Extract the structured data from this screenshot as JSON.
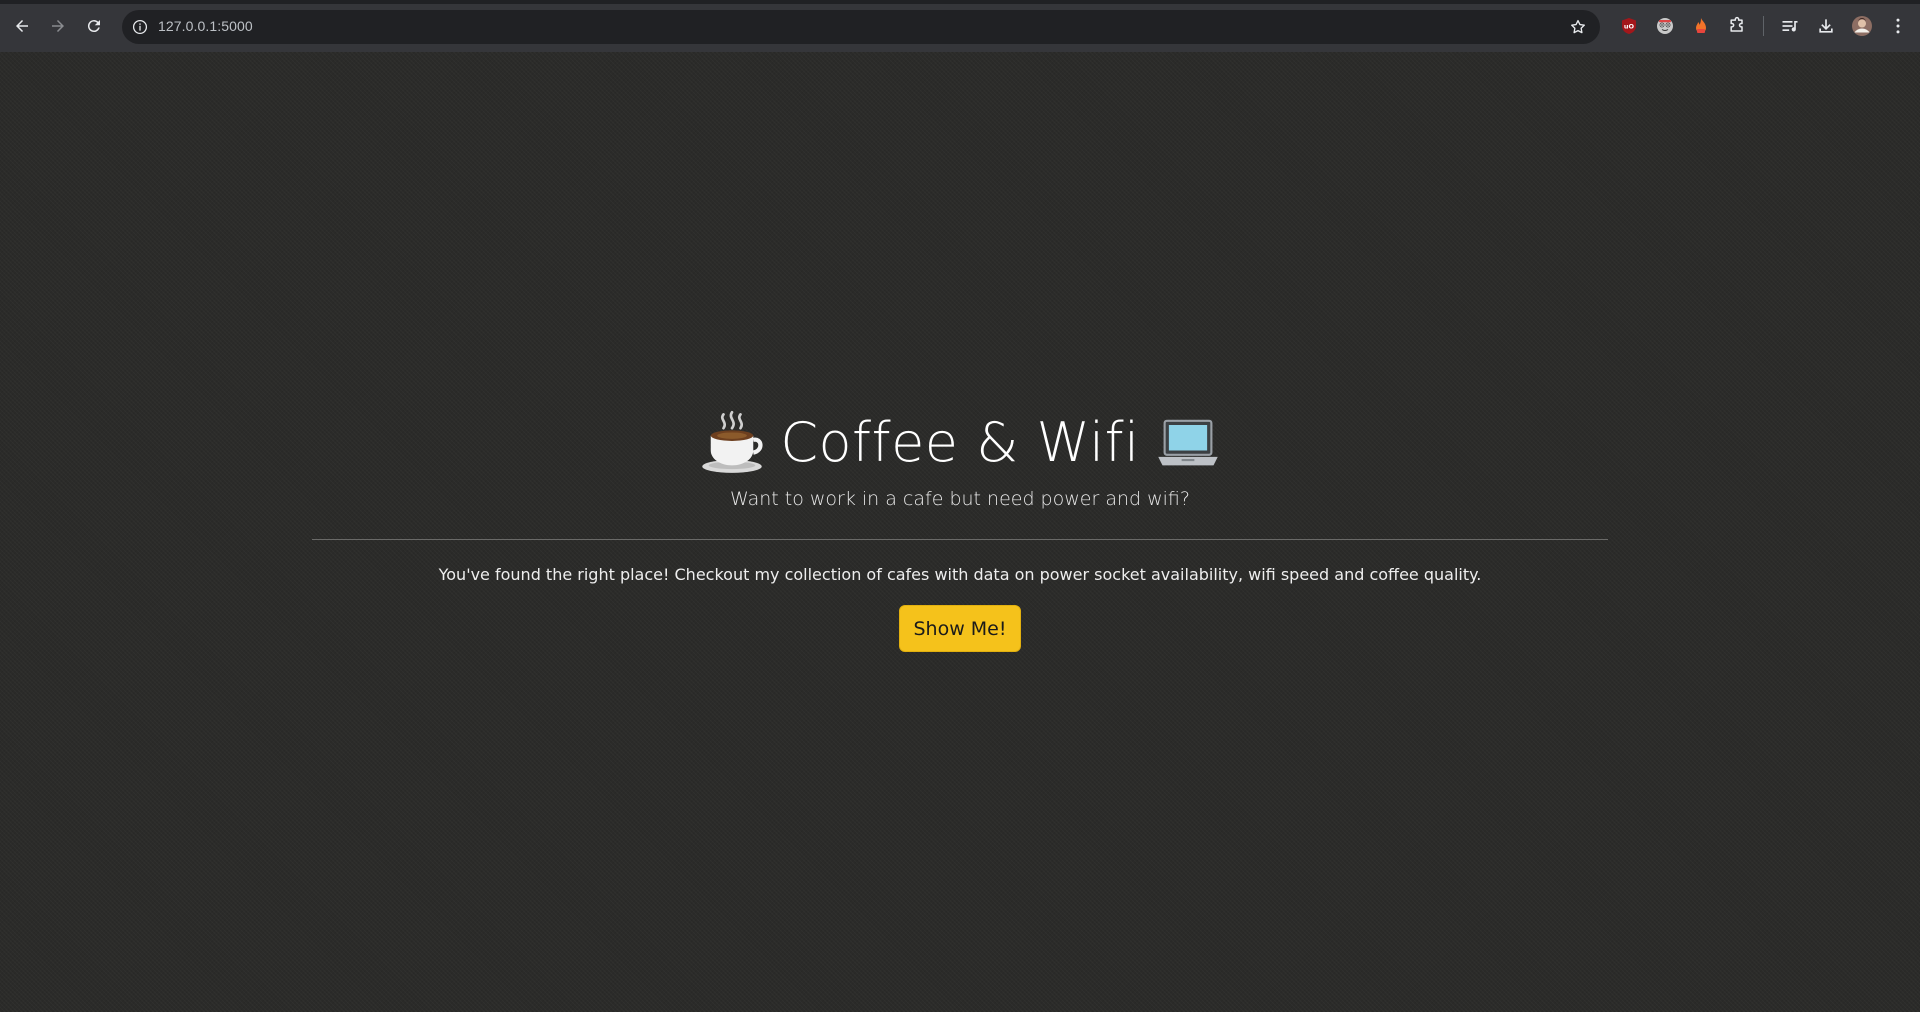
{
  "browser": {
    "url": "127.0.0.1:5000",
    "icons": {
      "back": "arrow-left-icon",
      "forward": "arrow-right-icon",
      "reload": "reload-icon",
      "site_info": "info-icon",
      "bookmark": "star-icon",
      "extensions": [
        "ublock-icon",
        "extension-face-icon",
        "extension-flame-icon",
        "puzzle-icon"
      ],
      "reading_list": "reading-list-icon",
      "downloads": "download-icon",
      "profile": "avatar",
      "menu": "kebab-menu-icon"
    }
  },
  "page": {
    "title": "Coffee & Wifi",
    "subtitle": "Want to work in a cafe but need power and wifi?",
    "lead": "You've found the right place! Checkout my collection of cafes with data on power socket availability, wifi speed and coffee quality.",
    "cta_label": "Show Me!"
  },
  "colors": {
    "page_background": "#2b2b29",
    "cta_background": "#f5c21b",
    "browser_toolbar": "#35363a"
  }
}
